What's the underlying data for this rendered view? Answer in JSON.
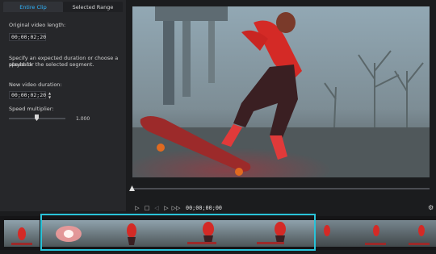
{
  "tabs": [
    {
      "label": "Entire Clip"
    },
    {
      "label": "Selected Range"
    }
  ],
  "left_panel": {
    "original_label": "Original video length:",
    "original_value": "00;00;02;20",
    "instruction": [
      "Specify an expected duration or choose a playback",
      "speed for the selected segment."
    ],
    "new_label": "New video duration:",
    "new_value": "00;00;02;20",
    "speed_label": "Speed multiplier:",
    "speed_value": "1.000",
    "speed_level": 0.5
  },
  "player": {
    "timecode": "00;00;00;00",
    "seek_position": 0
  },
  "colors": {
    "accent_tab": "#2fb6ff",
    "selection_border": "#29c3d9"
  }
}
